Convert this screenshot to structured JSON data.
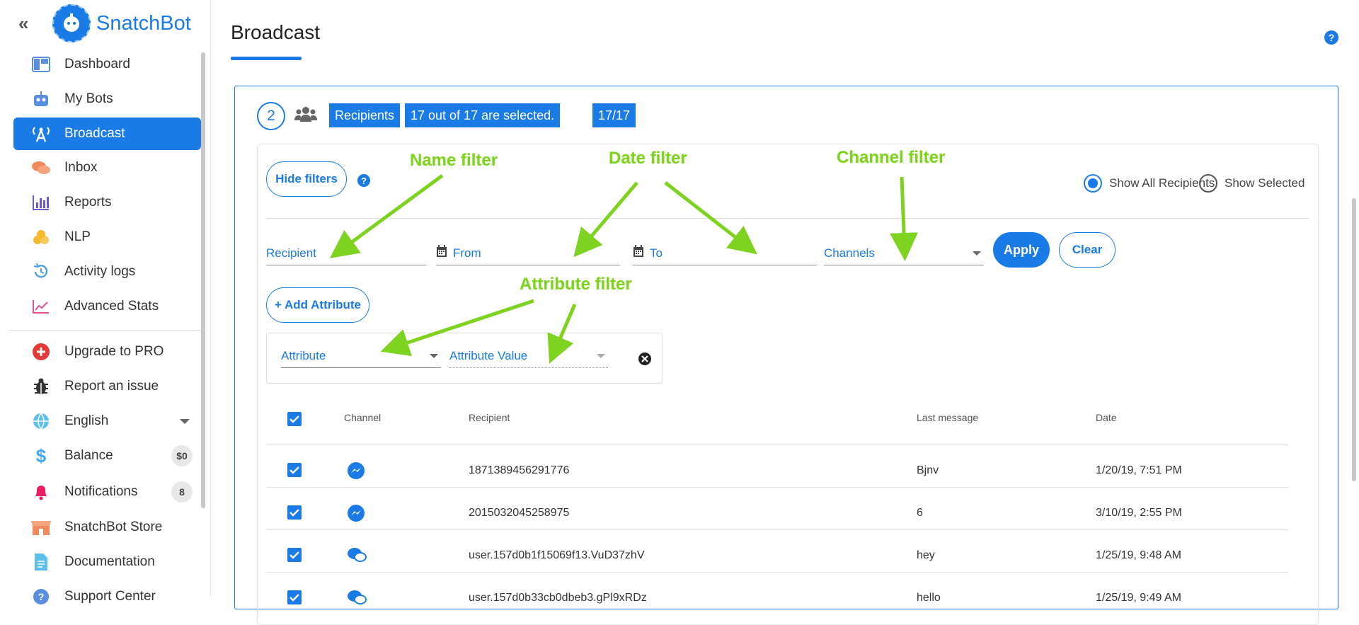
{
  "app": {
    "name": "SnatchBot",
    "collapse_icon": "double-chevron-left-icon"
  },
  "sidebar": {
    "items": [
      {
        "label": "Dashboard",
        "icon": "dashboard-icon",
        "active": false
      },
      {
        "label": "My Bots",
        "icon": "robot-icon",
        "active": false
      },
      {
        "label": "Broadcast",
        "icon": "broadcast-icon",
        "active": true
      },
      {
        "label": "Inbox",
        "icon": "chat-bubbles-icon",
        "active": false
      },
      {
        "label": "Reports",
        "icon": "bar-chart-icon",
        "active": false
      },
      {
        "label": "NLP",
        "icon": "coins-icon",
        "active": false
      },
      {
        "label": "Activity logs",
        "icon": "history-icon",
        "active": false
      },
      {
        "label": "Advanced Stats",
        "icon": "line-chart-icon",
        "active": false
      }
    ],
    "secondary": [
      {
        "label": "Upgrade to PRO",
        "icon": "plus-badge-icon"
      },
      {
        "label": "Report an issue",
        "icon": "bug-icon"
      },
      {
        "label": "English",
        "icon": "globe-icon",
        "dropdown": true
      },
      {
        "label": "Balance",
        "icon": "dollar-icon",
        "badge": "$0"
      },
      {
        "label": "Notifications",
        "icon": "bell-icon",
        "badge": "8"
      },
      {
        "label": "SnatchBot Store",
        "icon": "store-icon"
      },
      {
        "label": "Documentation",
        "icon": "document-icon"
      },
      {
        "label": "Support Center",
        "icon": "help-circle-icon"
      }
    ]
  },
  "page": {
    "title": "Broadcast",
    "help_icon": "help-circle-icon"
  },
  "step": {
    "number": "2",
    "recipients_label": "Recipients",
    "selection_text": "17 out of 17 are selected.",
    "count": "17/17"
  },
  "filters": {
    "hide_filters": "Hide filters",
    "show_all": "Show All Recipients",
    "show_selected": "Show Selected",
    "recipient_placeholder": "Recipient",
    "from_placeholder": "From",
    "to_placeholder": "To",
    "channels_placeholder": "Channels",
    "apply": "Apply",
    "clear": "Clear",
    "add_attribute": "+ Add Attribute",
    "attribute_placeholder": "Attribute",
    "attribute_value_placeholder": "Attribute Value"
  },
  "annotations": {
    "name_filter": "Name filter",
    "date_filter": "Date filter",
    "channel_filter": "Channel filter",
    "attribute_filter": "Attribute filter",
    "color": "#7ed321"
  },
  "table": {
    "headers": {
      "channel": "Channel",
      "recipient": "Recipient",
      "last_message": "Last message",
      "date": "Date"
    },
    "rows": [
      {
        "channel": "messenger-icon",
        "recipient": "1871389456291776",
        "last_message": "Bjnv",
        "date": "1/20/19, 7:51 PM"
      },
      {
        "channel": "messenger-icon",
        "recipient": "2015032045258975",
        "last_message": "6",
        "date": "3/10/19, 2:55 PM"
      },
      {
        "channel": "web-chat-icon",
        "recipient": "user.157d0b1f15069f13.VuD37zhV",
        "last_message": "hey",
        "date": "1/25/19, 9:48 AM"
      },
      {
        "channel": "web-chat-icon",
        "recipient": "user.157d0b33cb0dbeb3.gPl9xRDz",
        "last_message": "hello",
        "date": "1/25/19, 9:49 AM"
      }
    ]
  },
  "colors": {
    "accent": "#1a7be6",
    "annotation": "#7ed321"
  }
}
